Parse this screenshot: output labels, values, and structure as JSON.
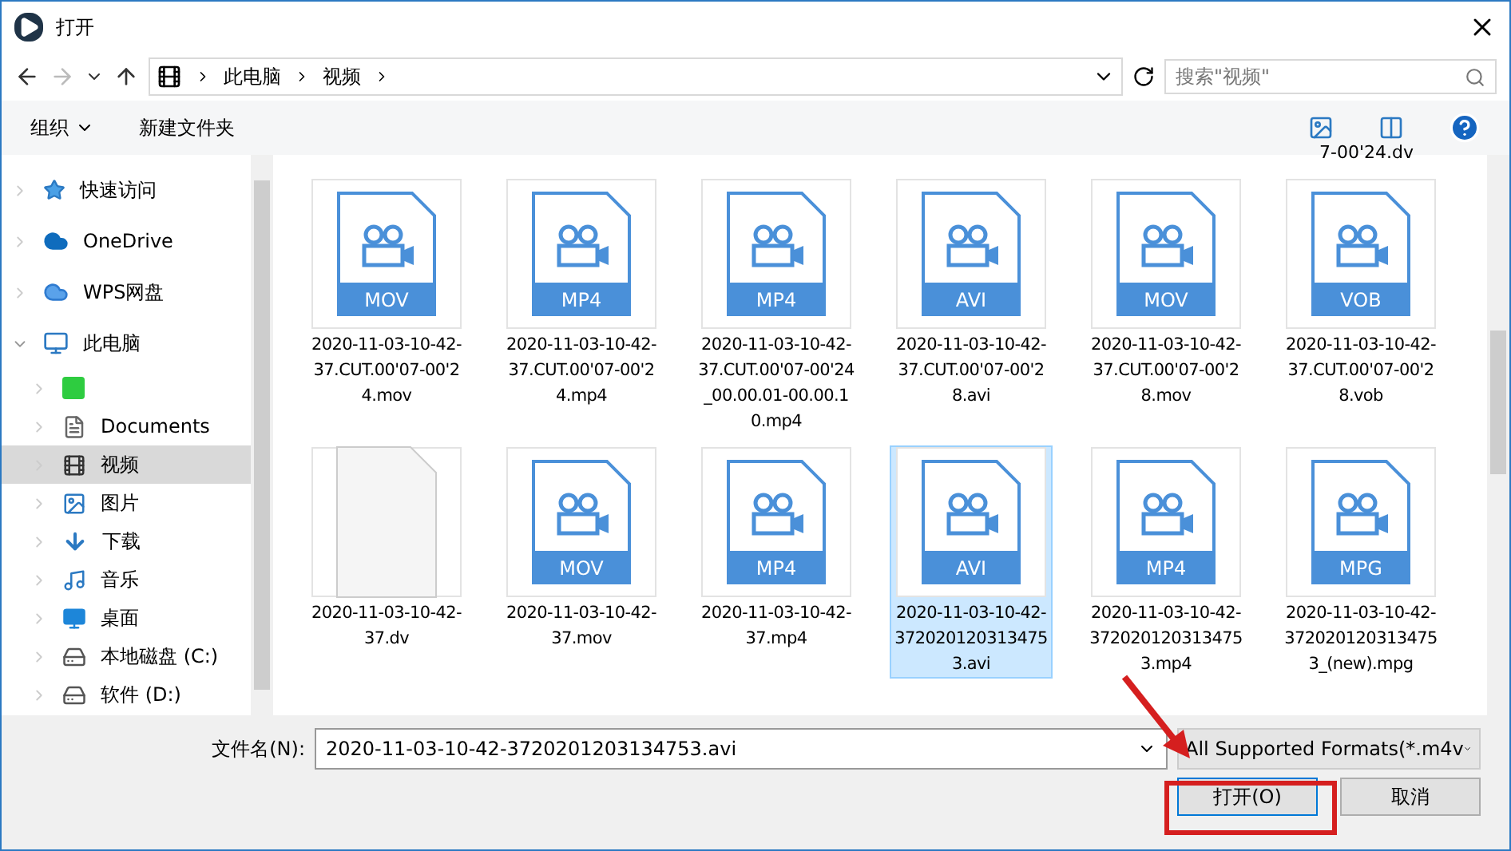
{
  "window": {
    "title": "打开"
  },
  "address": {
    "crumbs": [
      "此电脑",
      "视频"
    ],
    "search_placeholder": "搜索\"视频\""
  },
  "toolbar": {
    "organize": "组织",
    "new_folder": "新建文件夹"
  },
  "sidebar": {
    "items": [
      {
        "label": "快速访问",
        "selected": false,
        "expanded": false
      },
      {
        "label": "OneDrive",
        "selected": false,
        "expanded": false
      },
      {
        "label": "WPS网盘",
        "selected": false,
        "expanded": false
      },
      {
        "label": "此电脑",
        "selected": false,
        "expanded": true,
        "children": [
          {
            "selected": false,
            "expanded": false
          },
          {
            "label": "Documents",
            "selected": false,
            "expanded": false
          },
          {
            "label": "视频",
            "selected": true,
            "expanded": false
          },
          {
            "label": "图片",
            "selected": false,
            "expanded": false
          },
          {
            "label": "下载",
            "selected": false,
            "expanded": false
          },
          {
            "label": "音乐",
            "selected": false,
            "expanded": false
          },
          {
            "label": "桌面",
            "selected": false,
            "expanded": false
          },
          {
            "label": "本地磁盘 (C:)",
            "selected": false,
            "expanded": false
          },
          {
            "label": "软件 (D:)",
            "selected": false,
            "expanded": false
          }
        ]
      }
    ]
  },
  "partial_label": "7-00'24.dv",
  "files": [
    {
      "name": "2020-11-03-10-42-37.CUT.00'07-00'24.mov",
      "kind": "video",
      "type": "MOV",
      "selected": false
    },
    {
      "name": "2020-11-03-10-42-37.CUT.00'07-00'24.mp4",
      "kind": "video",
      "type": "MP4",
      "selected": false
    },
    {
      "name": "2020-11-03-10-42-37.CUT.00'07-00'24_00.00.01-00.00.10.mp4",
      "kind": "video",
      "type": "MP4",
      "selected": false
    },
    {
      "name": "2020-11-03-10-42-37.CUT.00'07-00'28.avi",
      "kind": "video",
      "type": "AVI",
      "selected": false
    },
    {
      "name": "2020-11-03-10-42-37.CUT.00'07-00'28.mov",
      "kind": "video",
      "type": "MOV",
      "selected": false
    },
    {
      "name": "2020-11-03-10-42-37.CUT.00'07-00'28.vob",
      "kind": "video",
      "type": "VOB",
      "selected": false
    },
    {
      "name": "2020-11-03-10-42-37.dv",
      "kind": "blank",
      "selected": false
    },
    {
      "name": "2020-11-03-10-42-37.mov",
      "kind": "video",
      "type": "MOV",
      "selected": false
    },
    {
      "name": "2020-11-03-10-42-37.mp4",
      "kind": "video",
      "type": "MP4",
      "selected": false
    },
    {
      "name": "2020-11-03-10-42-3720201203134753.avi",
      "kind": "video",
      "type": "AVI",
      "selected": true
    },
    {
      "name": "2020-11-03-10-42-3720201203134753.mp4",
      "kind": "video",
      "type": "MP4",
      "selected": false
    },
    {
      "name": "2020-11-03-10-42-3720201203134753_(new).mpg",
      "kind": "video",
      "type": "MPG",
      "selected": false
    }
  ],
  "footer": {
    "filename_label": "文件名(N):",
    "filename": "2020-11-03-10-42-3720201203134753.avi",
    "filter": "All Supported Formats(*.m4v",
    "open": "打开(O)",
    "cancel": "取消"
  }
}
